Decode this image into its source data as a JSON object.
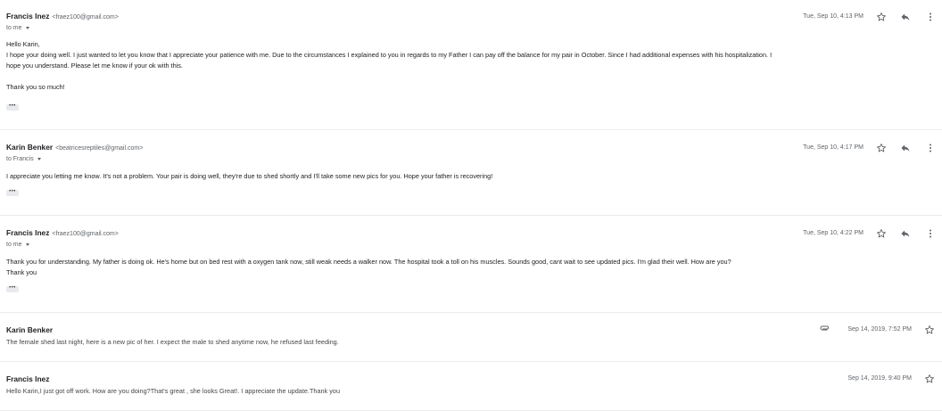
{
  "messages": [
    {
      "sender": "Francis Inez",
      "email": "<fraez100@gmail.com>",
      "to": "to me",
      "date": "Tue, Sep 10, 4:13 PM",
      "body_lines": [
        "Hello Karin,",
        "I hope your doing well. I just wanted to let you know that I appreciate your patience with me. Due to the circumstances I explained to you in regards to my Father I can pay off the balance for my pair in October. Since I had additional expenses with his hospitalization. I",
        "hope you understand. Please let me know if your ok with this.",
        "",
        "Thank you so much!"
      ]
    },
    {
      "sender": "Karin Benker",
      "email": "<beatricesreptiles@gmail.com>",
      "to": "to Francis",
      "date": "Tue, Sep 10, 4:17 PM",
      "body_lines": [
        "I appreciate you letting me know. It's not a problem. Your pair is doing well, they're due to shed shortly and I'll take some new pics for you. Hope your father is recovering!"
      ]
    },
    {
      "sender": "Francis Inez",
      "email": "<fraez100@gmail.com>",
      "to": "to me",
      "date": "Tue, Sep 10, 4:22 PM",
      "body_lines": [
        "Thank you for understanding. My father is doing ok. He's home but on bed rest with a oxygen tank now, still weak needs a walker now. The hospital took a toll on his muscles. Sounds good, cant wait to see updated pics. I'm glad their well. How are you?",
        "Thank you"
      ]
    },
    {
      "sender": "Karin Benker",
      "date": "Sep 14, 2019, 7:52 PM",
      "snippet": "The female shed last night, here is a new pic of her. I expect the male to shed anytime now, he refused last feeding.",
      "has_attachment": true
    },
    {
      "sender": "Francis Inez",
      "date": "Sep 14, 2019, 9:40 PM",
      "snippet": "Hello Karin,I just got off work. How are you doing?That's great , she looks Great!. I appreciate the update.Thank you"
    }
  ],
  "icons": {
    "star": "star-icon",
    "reply": "reply-icon",
    "more": "more-vert-icon",
    "attachment": "paperclip-icon",
    "expand": "ellipsis-icon"
  },
  "colors": {
    "text": "#222222",
    "secondary": "#5f6368",
    "divider": "#ececec"
  }
}
